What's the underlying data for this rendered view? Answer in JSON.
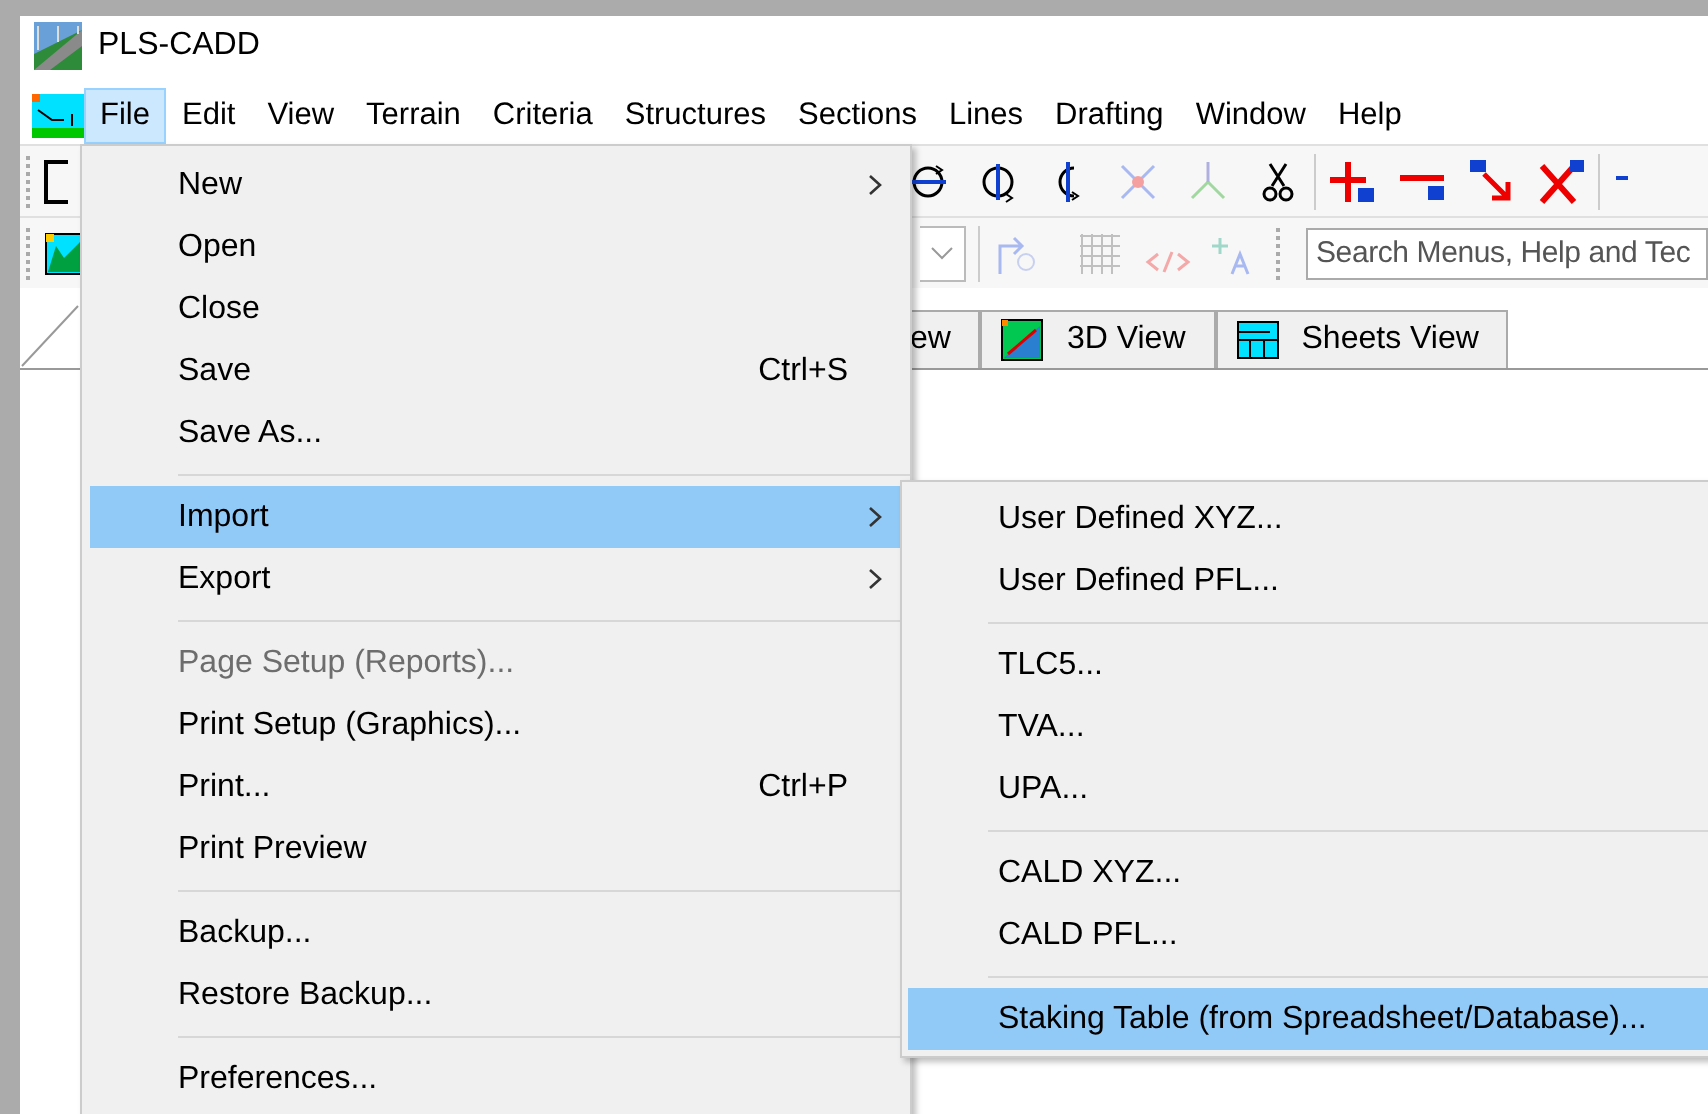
{
  "window": {
    "title": "PLS-CADD"
  },
  "menu_bar": [
    {
      "label": "File",
      "selected": true
    },
    {
      "label": "Edit",
      "selected": false
    },
    {
      "label": "View",
      "selected": false
    },
    {
      "label": "Terrain",
      "selected": false
    },
    {
      "label": "Criteria",
      "selected": false
    },
    {
      "label": "Structures",
      "selected": false
    },
    {
      "label": "Sections",
      "selected": false
    },
    {
      "label": "Lines",
      "selected": false
    },
    {
      "label": "Drafting",
      "selected": false
    },
    {
      "label": "Window",
      "selected": false
    },
    {
      "label": "Help",
      "selected": false
    }
  ],
  "toolbar": {
    "search": {
      "placeholder": "Search Menus, Help and Tec"
    }
  },
  "view_tabs": [
    {
      "label": "ew",
      "kind": "plain"
    },
    {
      "label": "3D View",
      "kind": "model"
    },
    {
      "label": "Sheets View",
      "kind": "sheets"
    }
  ],
  "file_menu": [
    {
      "kind": "item",
      "label": "New",
      "submenu": true,
      "disabled": false,
      "selected": false
    },
    {
      "kind": "item",
      "label": "Open",
      "submenu": false,
      "disabled": false,
      "selected": false
    },
    {
      "kind": "item",
      "label": "Close",
      "submenu": false,
      "disabled": false,
      "selected": false
    },
    {
      "kind": "item",
      "label": "Save",
      "shortcut": "Ctrl+S",
      "submenu": false,
      "disabled": false,
      "selected": false
    },
    {
      "kind": "item",
      "label": "Save As...",
      "submenu": false,
      "disabled": false,
      "selected": false
    },
    {
      "kind": "separator"
    },
    {
      "kind": "item",
      "label": "Import",
      "submenu": true,
      "disabled": false,
      "selected": true
    },
    {
      "kind": "item",
      "label": "Export",
      "submenu": true,
      "disabled": false,
      "selected": false
    },
    {
      "kind": "separator"
    },
    {
      "kind": "item",
      "label": "Page Setup (Reports)...",
      "submenu": false,
      "disabled": true,
      "selected": false
    },
    {
      "kind": "item",
      "label": "Print Setup (Graphics)...",
      "submenu": false,
      "disabled": false,
      "selected": false
    },
    {
      "kind": "item",
      "label": "Print...",
      "shortcut": "Ctrl+P",
      "submenu": false,
      "disabled": false,
      "selected": false
    },
    {
      "kind": "item",
      "label": "Print Preview",
      "submenu": false,
      "disabled": false,
      "selected": false
    },
    {
      "kind": "separator"
    },
    {
      "kind": "item",
      "label": "Backup...",
      "submenu": false,
      "disabled": false,
      "selected": false
    },
    {
      "kind": "item",
      "label": "Restore Backup...",
      "submenu": false,
      "disabled": false,
      "selected": false
    },
    {
      "kind": "separator"
    },
    {
      "kind": "item",
      "label": "Preferences...",
      "submenu": false,
      "disabled": false,
      "selected": false
    }
  ],
  "import_submenu": [
    {
      "kind": "item",
      "label": "User Defined XYZ...",
      "selected": false
    },
    {
      "kind": "item",
      "label": "User Defined PFL...",
      "selected": false
    },
    {
      "kind": "separator"
    },
    {
      "kind": "item",
      "label": "TLC5...",
      "selected": false
    },
    {
      "kind": "item",
      "label": "TVA...",
      "selected": false
    },
    {
      "kind": "item",
      "label": "UPA...",
      "selected": false
    },
    {
      "kind": "separator"
    },
    {
      "kind": "item",
      "label": "CALD XYZ...",
      "selected": false
    },
    {
      "kind": "item",
      "label": "CALD PFL...",
      "selected": false
    },
    {
      "kind": "separator"
    },
    {
      "kind": "item",
      "label": "Staking Table (from Spreadsheet/Database)...",
      "selected": true
    }
  ]
}
